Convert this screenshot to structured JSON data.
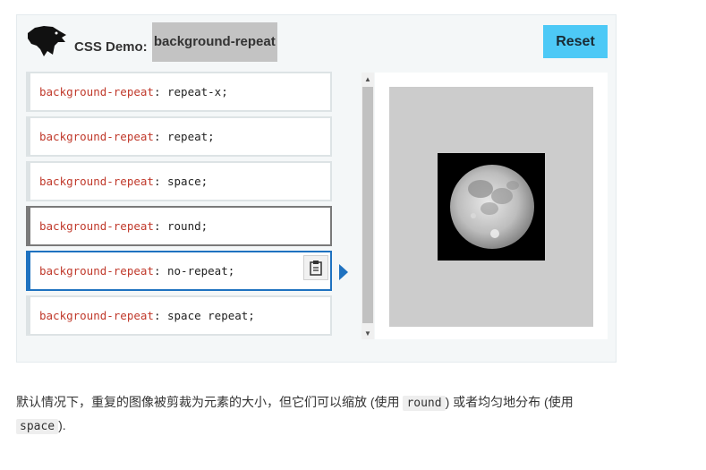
{
  "header": {
    "title_prefix": "CSS Demo:",
    "title_property": "background-repeat",
    "reset_label": "Reset"
  },
  "choices": [
    {
      "property": "background-repeat",
      "separator": ":",
      "value": " repeat-x;"
    },
    {
      "property": "background-repeat",
      "separator": ":",
      "value": " repeat;"
    },
    {
      "property": "background-repeat",
      "separator": ":",
      "value": " space;"
    },
    {
      "property": "background-repeat",
      "separator": ":",
      "value": " round;"
    },
    {
      "property": "background-repeat",
      "separator": ":",
      "value": " no-repeat;"
    },
    {
      "property": "background-repeat",
      "separator": ":",
      "value": " space repeat;"
    }
  ],
  "description": {
    "part1": "默认情况下，重复的图像被剪裁为元素的大小，但它们可以缩放 (使用 ",
    "code1": "round",
    "part2": ") 或者均匀地分布 (使用 ",
    "code2": "space",
    "part3": ")."
  },
  "colors": {
    "accent": "#4dc9f6",
    "selected_border": "#1f72c0",
    "property_text": "#c0392b"
  },
  "icons": {
    "logo": "dinosaur-logo-icon",
    "copy": "clipboard-icon",
    "indicator": "triangle-right-icon"
  }
}
